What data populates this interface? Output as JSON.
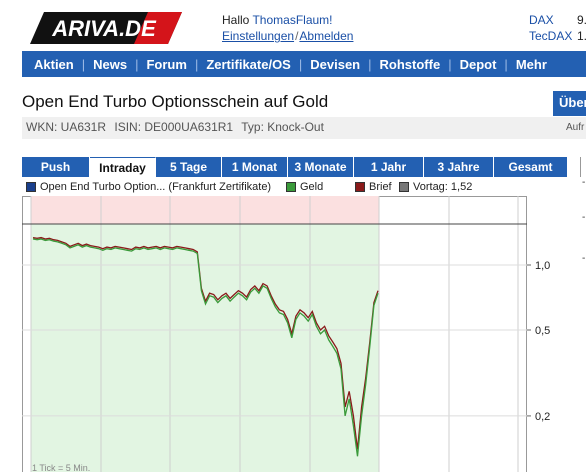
{
  "header": {
    "logo_text": "ARIVA.DE",
    "greeting_prefix": "Hallo ",
    "user_name": "ThomasFlaum!",
    "settings_link": "Einstellungen",
    "link_separator": "/",
    "logout_link": "Abmelden",
    "indices": [
      {
        "name": "DAX",
        "value": "9."
      },
      {
        "name": "TecDAX",
        "value": "1."
      }
    ]
  },
  "nav": {
    "items": [
      "Aktien",
      "News",
      "Forum",
      "Zertifikate/OS",
      "Devisen",
      "Rohstoffe",
      "Depot",
      "Mehr"
    ]
  },
  "page": {
    "title": "Open End Turbo Optionsschein auf Gold",
    "uber_button": "Über",
    "wkn": "WKN: UA631R",
    "isin": "ISIN: DE000UA631R1",
    "typ": "Typ: Knock-Out",
    "aufr": "Aufr"
  },
  "tabs": {
    "items": [
      "Push",
      "Intraday",
      "5 Tage",
      "1 Monat",
      "3 Monate",
      "1 Jahr",
      "3 Jahre",
      "Gesamt"
    ],
    "active": 1
  },
  "legend": {
    "main": "Open End Turbo Option... (Frankfurt Zertifikate)",
    "geld": "Geld",
    "brief": "Brief",
    "vortag": "Vortag: 1,52"
  },
  "colors": {
    "nav_blue": "#2360b2",
    "series_main": "#1a3f8c",
    "geld": "#3a9a3a",
    "brief": "#8a1a1a",
    "vortag": "#777777",
    "area_above": "#fbe0e0",
    "area_below": "#e2f5e2"
  },
  "chart_data": {
    "type": "line",
    "y_scale": "log",
    "yticks": [
      "1,0",
      "0,5",
      "0,2"
    ],
    "footnote": "1 Tick = 5 Min.",
    "vortag_value": 1.52,
    "x_unit": "5-min ticks",
    "series": [
      {
        "name": "Brief",
        "values": [
          1.34,
          1.33,
          1.34,
          1.32,
          1.33,
          1.31,
          1.3,
          1.28,
          1.26,
          1.22,
          1.24,
          1.26,
          1.23,
          1.25,
          1.23,
          1.22,
          1.21,
          1.19,
          1.21,
          1.2,
          1.22,
          1.21,
          1.2,
          1.19,
          1.18,
          1.21,
          1.2,
          1.22,
          1.2,
          1.21,
          1.22,
          1.2,
          1.22,
          1.21,
          1.2,
          1.22,
          1.21,
          1.2,
          1.19,
          1.18,
          1.15,
          0.78,
          0.68,
          0.74,
          0.73,
          0.69,
          0.72,
          0.74,
          0.7,
          0.73,
          0.76,
          0.74,
          0.71,
          0.77,
          0.8,
          0.76,
          0.82,
          0.8,
          0.72,
          0.66,
          0.62,
          0.61,
          0.56,
          0.48,
          0.58,
          0.62,
          0.6,
          0.57,
          0.61,
          0.54,
          0.5,
          0.52,
          0.47,
          0.44,
          0.41,
          0.35,
          0.22,
          0.26,
          0.2,
          0.14,
          0.22,
          0.3,
          0.44,
          0.67,
          0.76
        ]
      },
      {
        "name": "Geld",
        "values": [
          1.32,
          1.31,
          1.32,
          1.3,
          1.31,
          1.29,
          1.28,
          1.26,
          1.24,
          1.2,
          1.22,
          1.24,
          1.21,
          1.23,
          1.21,
          1.2,
          1.19,
          1.17,
          1.19,
          1.18,
          1.2,
          1.19,
          1.18,
          1.17,
          1.16,
          1.19,
          1.18,
          1.2,
          1.18,
          1.19,
          1.2,
          1.18,
          1.2,
          1.19,
          1.18,
          1.2,
          1.19,
          1.18,
          1.17,
          1.16,
          1.13,
          0.76,
          0.66,
          0.72,
          0.71,
          0.67,
          0.7,
          0.72,
          0.68,
          0.71,
          0.74,
          0.72,
          0.69,
          0.75,
          0.78,
          0.74,
          0.8,
          0.78,
          0.7,
          0.64,
          0.6,
          0.59,
          0.54,
          0.46,
          0.56,
          0.6,
          0.58,
          0.55,
          0.59,
          0.52,
          0.48,
          0.5,
          0.45,
          0.42,
          0.39,
          0.33,
          0.2,
          0.24,
          0.18,
          0.13,
          0.2,
          0.28,
          0.42,
          0.65,
          0.74
        ]
      }
    ]
  }
}
